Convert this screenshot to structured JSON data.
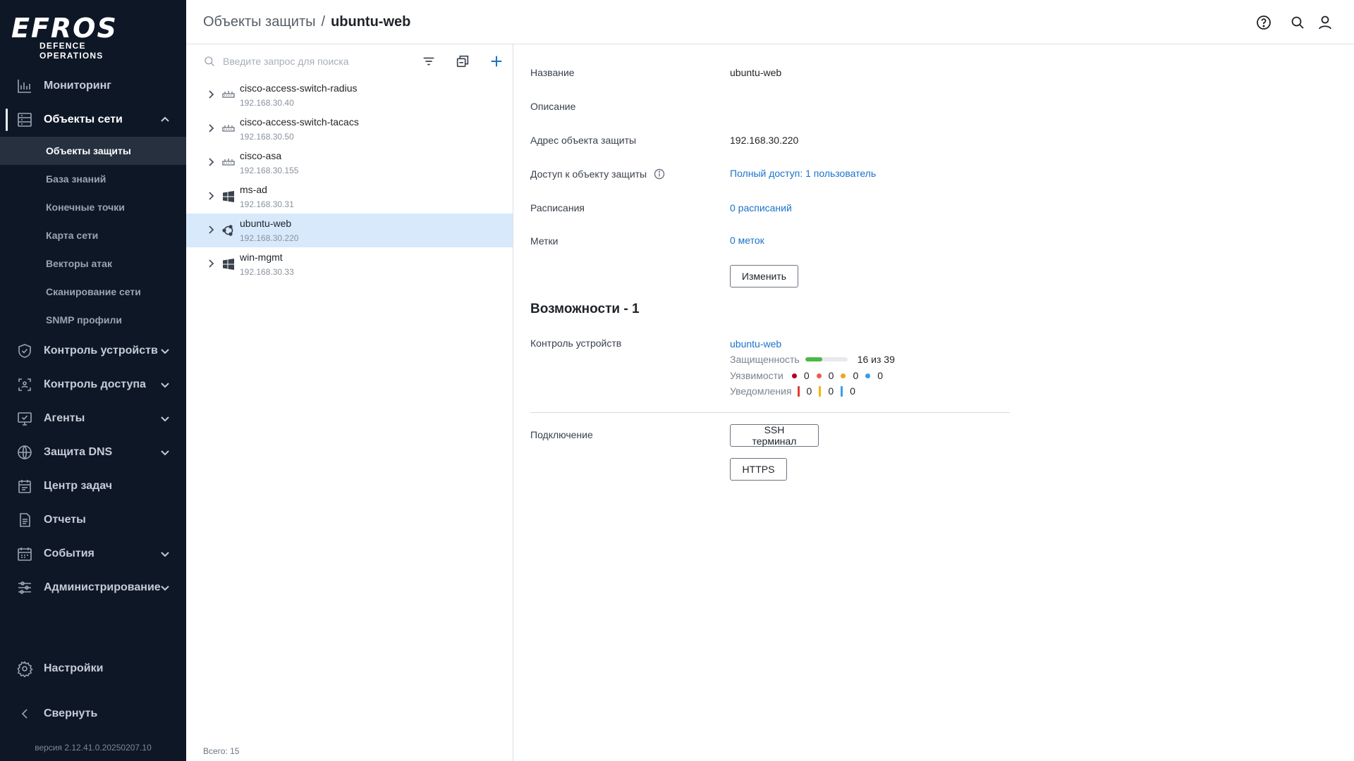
{
  "app": {
    "logo_text": "EFROS",
    "logo_subtitle": "DEFENCE OPERATIONS",
    "version": "версия 2.12.41.0.20250207.10"
  },
  "sidebar": {
    "items": [
      {
        "label": "Мониторинг",
        "icon": "chart-bars-icon"
      },
      {
        "label": "Объекты сети",
        "icon": "server-list-icon"
      },
      {
        "label": "Контроль устройств",
        "icon": "shield-check-icon"
      },
      {
        "label": "Контроль доступа",
        "icon": "access-scan-icon"
      },
      {
        "label": "Агенты",
        "icon": "monitor-check-icon"
      },
      {
        "label": "Защита DNS",
        "icon": "globe-icon"
      },
      {
        "label": "Центр задач",
        "icon": "calendar-task-icon"
      },
      {
        "label": "Отчеты",
        "icon": "document-icon"
      },
      {
        "label": "События",
        "icon": "calendar-icon"
      },
      {
        "label": "Администрирование",
        "icon": "sliders-icon"
      }
    ],
    "subitems": [
      {
        "label": "Объекты защиты"
      },
      {
        "label": "База знаний"
      },
      {
        "label": "Конечные точки"
      },
      {
        "label": "Карта сети"
      },
      {
        "label": "Векторы атак"
      },
      {
        "label": "Сканирование сети"
      },
      {
        "label": "SNMP профили"
      }
    ],
    "settings_label": "Настройки",
    "collapse_label": "Свернуть"
  },
  "header": {
    "breadcrumb_parent": "Объекты защиты",
    "breadcrumb_sep": "/",
    "breadcrumb_current": "ubuntu-web"
  },
  "list": {
    "search_placeholder": "Введите запрос для поиска",
    "items": [
      {
        "name": "cisco-access-switch-radius",
        "ip": "192.168.30.40",
        "icon": "network-switch-icon"
      },
      {
        "name": "cisco-access-switch-tacacs",
        "ip": "192.168.30.50",
        "icon": "network-switch-icon"
      },
      {
        "name": "cisco-asa",
        "ip": "192.168.30.155",
        "icon": "network-switch-icon"
      },
      {
        "name": "ms-ad",
        "ip": "192.168.30.31",
        "icon": "windows-icon"
      },
      {
        "name": "ubuntu-web",
        "ip": "192.168.30.220",
        "icon": "ubuntu-icon"
      },
      {
        "name": "win-mgmt",
        "ip": "192.168.30.33",
        "icon": "windows-icon"
      }
    ],
    "total": "Всего: 15"
  },
  "details": {
    "name_label": "Название",
    "name_value": "ubuntu-web",
    "desc_label": "Описание",
    "address_label": "Адрес объекта защиты",
    "address_value": "192.168.30.220",
    "access_label": "Доступ к объекту защиты",
    "access_value": "Полный доступ: 1 пользователь",
    "schedules_label": "Расписания",
    "schedules_value": "0 расписаний",
    "tags_label": "Метки",
    "tags_value": "0 меток",
    "edit_button": "Изменить",
    "capabilities_title": "Возможности - 1",
    "device_control_label": "Контроль устройств",
    "device_control_link": "ubuntu-web",
    "security_label": "Защищенность",
    "security_text": "16 из 39",
    "security_fraction": 0.41,
    "vuln_label": "Уязвимости",
    "vuln_values": [
      "0",
      "0",
      "0",
      "0"
    ],
    "notif_label": "Уведомления",
    "notif_values": [
      "0",
      "0",
      "0"
    ],
    "connection_label": "Подключение",
    "ssh_button": "SSH терминал",
    "https_button": "HTTPS"
  },
  "colors": {
    "sidebar_bg": "#0e1726",
    "accent": "#1a73c9",
    "selected_row": "#d7e9fb",
    "vuln_critical": "#b00020",
    "vuln_high": "#f05a4a",
    "vuln_medium": "#f2a51a",
    "vuln_low": "#3d9be9",
    "notif_red": "#e53935",
    "notif_yellow": "#f5b400",
    "notif_blue": "#3d9be9",
    "security_bar": "#4cb846"
  }
}
